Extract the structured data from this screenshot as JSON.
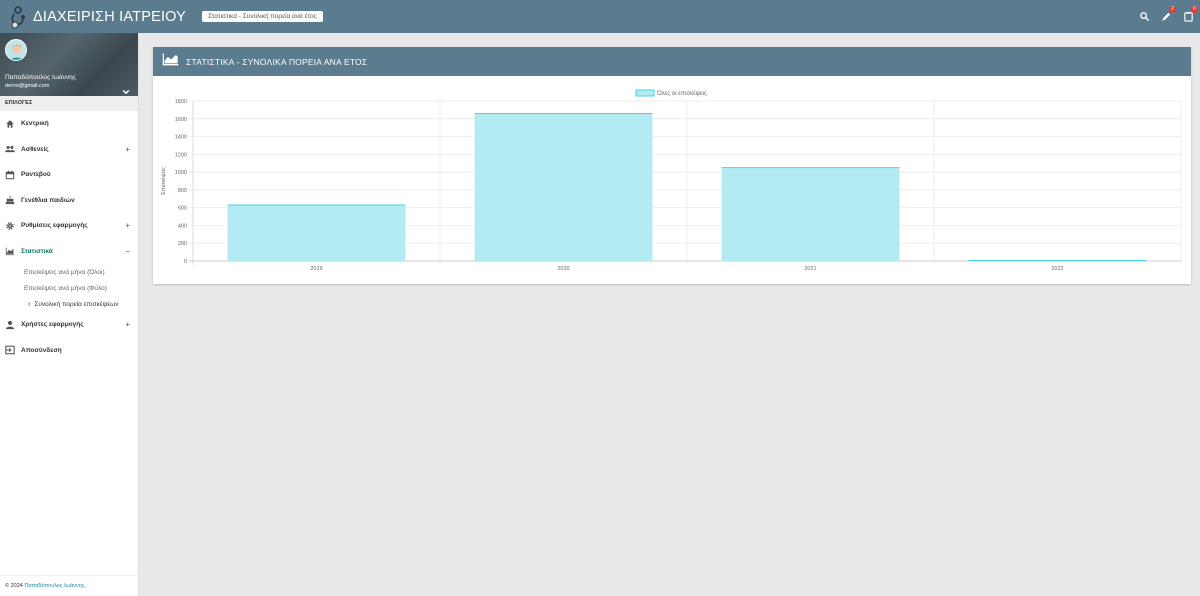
{
  "header": {
    "app_title": "ΔΙΑΧΕΙΡΙΣΗ ΙΑΤΡΕΙΟΥ",
    "breadcrumb": "Στατιστικά - Συνολική πορεία ανά έτος",
    "notifications_count": "2",
    "tasks_count": "0"
  },
  "user": {
    "name": "Παπαδόπουλος Ιωάννης",
    "email": "demo@gmail.com"
  },
  "sidebar": {
    "section_label": "ΕΠΙΛΟΓΕΣ",
    "items": [
      {
        "label": "Κεντρική",
        "icon": "home-icon"
      },
      {
        "label": "Ασθενείς",
        "icon": "people-icon",
        "expandable": "+"
      },
      {
        "label": "Ραντεβού",
        "icon": "calendar-icon"
      },
      {
        "label": "Γενέθλια παιδιών",
        "icon": "cake-icon"
      },
      {
        "label": "Ρυθμίσεις εφαρμογής",
        "icon": "gear-icon",
        "expandable": "+"
      },
      {
        "label": "Στατιστικά",
        "icon": "chart-icon",
        "expandable": "−"
      },
      {
        "label": "Χρήστες εφαρμογής",
        "icon": "person-icon",
        "expandable": "+"
      },
      {
        "label": "Αποσύνδεση",
        "icon": "logout-icon"
      }
    ],
    "stats_submenu": [
      "Επισκέψεις ανά μήνα (Όλοι)",
      "Επισκέψεις ανά μήνα (Φύλο)",
      "Συνολική πορεία επισκέψεων"
    ]
  },
  "footer": {
    "copyright": "© 2024",
    "author": "Παπαδόπουλος Ιωάννης",
    "suffix": "."
  },
  "card": {
    "title": "ΣΤΑΤΙΣΤΙΚΑ - ΣΥΝΟΛΙΚΑ ΠΟΡΕΙΑ ΑΝΑ ΕΤΟΣ"
  },
  "colors": {
    "topbar": "#5b7b8e",
    "bar_fill": "#b2ebf2",
    "bar_stroke": "#4dd0e1"
  },
  "chart_data": {
    "type": "bar",
    "categories": [
      "2019",
      "2020",
      "2021",
      "2022"
    ],
    "series": [
      {
        "name": "Όλες οι επισκέψεις",
        "values": [
          630,
          1660,
          1050,
          5
        ]
      }
    ],
    "ylabel": "Επισκέψεις",
    "xlabel": "",
    "ylim": [
      0,
      1800
    ],
    "yticks": [
      0,
      200,
      400,
      600,
      800,
      1000,
      1200,
      1400,
      1600,
      1800
    ],
    "grid": true,
    "legend": "top"
  }
}
